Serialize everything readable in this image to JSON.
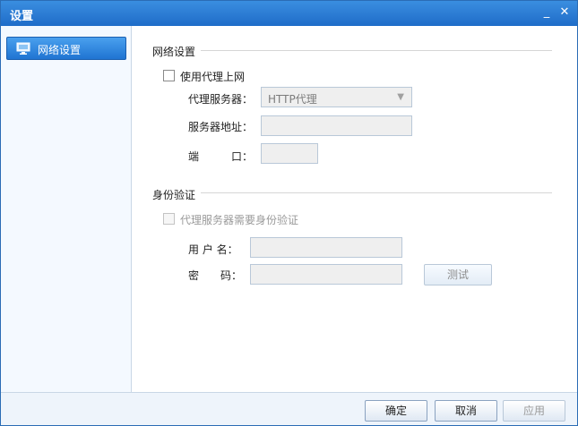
{
  "window": {
    "title": "设置"
  },
  "titlebar": {
    "minimize_glyph": "_",
    "close_glyph": "✕"
  },
  "sidebar": {
    "items": [
      {
        "label": "网络设置",
        "icon": "monitor-icon",
        "selected": true
      }
    ]
  },
  "network": {
    "section_title": "网络设置",
    "use_proxy_label": "使用代理上网",
    "use_proxy_checked": false,
    "proxy_server_label": "代理服务器：",
    "proxy_server_value": "HTTP代理",
    "server_address_label": "服务器地址：",
    "server_address_value": "",
    "port_label_a": "端",
    "port_label_b": "口：",
    "port_value": ""
  },
  "auth": {
    "section_title": "身份验证",
    "require_auth_label": "代理服务器需要身份验证",
    "require_auth_checked": false,
    "username_label": "用 户 名：",
    "username_value": "",
    "password_label_a": "密",
    "password_label_b": "码：",
    "password_value": "",
    "test_button": "测试"
  },
  "footer": {
    "ok": "确定",
    "cancel": "取消",
    "apply": "应用"
  },
  "colors": {
    "accent": "#1f6cc8",
    "sidebar_bg": "#f4f9ff",
    "footer_bg": "#eef4fb"
  }
}
